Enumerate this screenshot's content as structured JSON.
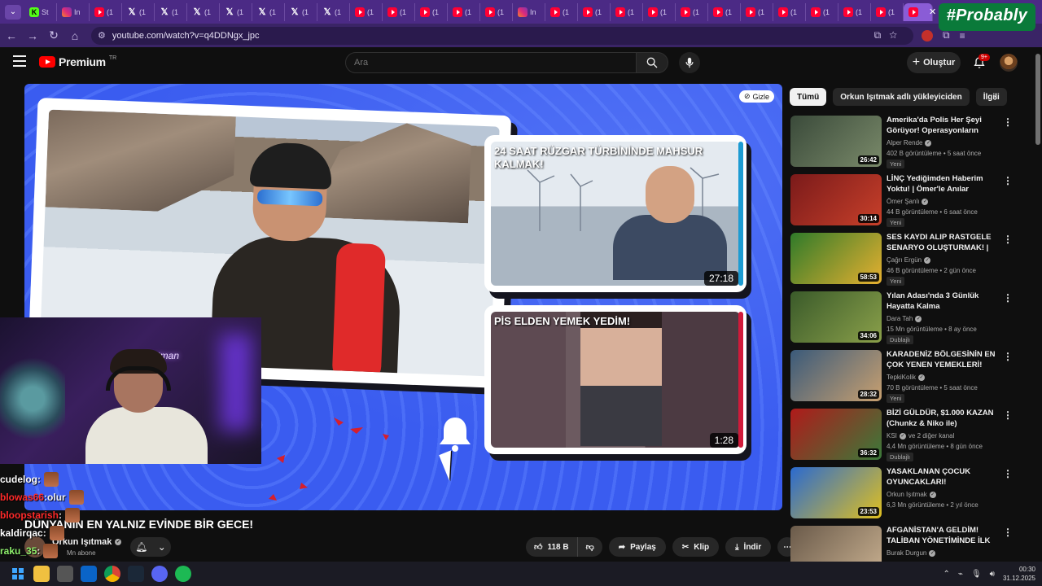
{
  "browser": {
    "tabs": [
      {
        "icon": "kick",
        "title": "St"
      },
      {
        "icon": "instagram",
        "title": "In"
      },
      {
        "icon": "youtube",
        "title": "(1"
      },
      {
        "icon": "x",
        "title": "(1"
      },
      {
        "icon": "x",
        "title": "(1"
      },
      {
        "icon": "x",
        "title": "(1"
      },
      {
        "icon": "x",
        "title": "(1"
      },
      {
        "icon": "x",
        "title": "(1"
      },
      {
        "icon": "x",
        "title": "(1"
      },
      {
        "icon": "x",
        "title": "(1"
      },
      {
        "icon": "youtube",
        "title": "(1"
      },
      {
        "icon": "youtube",
        "title": "(1"
      },
      {
        "icon": "youtube",
        "title": "(1"
      },
      {
        "icon": "youtube",
        "title": "(1"
      },
      {
        "icon": "youtube",
        "title": "(1"
      },
      {
        "icon": "instagram",
        "title": "In"
      },
      {
        "icon": "youtube",
        "title": "(1"
      },
      {
        "icon": "youtube",
        "title": "(1"
      },
      {
        "icon": "youtube",
        "title": "(1"
      },
      {
        "icon": "youtube",
        "title": "(1"
      },
      {
        "icon": "youtube",
        "title": "(1"
      },
      {
        "icon": "youtube",
        "title": "(1"
      },
      {
        "icon": "youtube",
        "title": "(1"
      },
      {
        "icon": "youtube",
        "title": "(1"
      },
      {
        "icon": "youtube",
        "title": "(1"
      },
      {
        "icon": "youtube",
        "title": "(1"
      },
      {
        "icon": "youtube",
        "title": "(1"
      }
    ],
    "active_tab_close": "✕",
    "url": "youtube.com/watch?v=q4DDNgx_jpc"
  },
  "overlay": {
    "brand_badge": "#Probably"
  },
  "youtube": {
    "logo_text": "Premium",
    "logo_tr": "TR",
    "search_placeholder": "Ara",
    "create_label": "Oluştur",
    "notif_count": "9+"
  },
  "player": {
    "hide_label": "Gizle",
    "card1_title": "24 SAAT RÜZGAR TÜRBİNİNDE MAHSUR KALMAK!",
    "card1_duration": "27:18",
    "card2_title": "PİS ELDEN YEMEK YEDİM!",
    "card2_duration": "1:28",
    "webcam_neon": "hotman"
  },
  "chat": [
    {
      "user": "cudelog",
      "sep": " :",
      "text": "",
      "color": "#ffffff"
    },
    {
      "user": "blowas66",
      "sep": " :",
      "text": " olur",
      "color": "#ff2a2a"
    },
    {
      "user": "bloopstarish",
      "sep": " :",
      "text": "",
      "color": "#ff2a2a"
    },
    {
      "user": "kaldirqac",
      "sep": " :",
      "text": "",
      "color": "#ffffff"
    },
    {
      "user": "raku_35",
      "sep": " :",
      "text": "",
      "color": "#8ef06c"
    }
  ],
  "video": {
    "title": "DÜNYANIN EN YALNIZ EVİNDE BİR GECE!",
    "channel": "Orkun Işıtmak",
    "subs": "Mn abone",
    "likes": "118 B",
    "share": "Paylaş",
    "clip": "Klip",
    "download": "İndir"
  },
  "chips": [
    "Tümü",
    "Orkun Işıtmak adlı yükleyiciden",
    "İlgili"
  ],
  "recommendations": [
    {
      "title": "Amerika'da Polis Her Şeyi Görüyor! Operasyonların Perde...",
      "channel": "Alper Rende",
      "meta": "402 B görüntüleme • 5 saat önce",
      "tag": "Yeni",
      "duration": "26:42",
      "colors": [
        "#3a4a3a",
        "#7a8a6a"
      ]
    },
    {
      "title": "LİNÇ Yediğimden Haberim Yoktu! | Ömer'le Anılar @gokalaf",
      "channel": "Ömer Şanlı",
      "meta": "44 B görüntüleme • 6 saat önce",
      "tag": "Yeni",
      "duration": "30:14",
      "colors": [
        "#7a1a1a",
        "#c8402a"
      ]
    },
    {
      "title": "SES KAYDI ALIP RASTGELE SENARYO OLUŞTURMAK! | Th...",
      "channel": "Çağrı Ergün",
      "meta": "46 B görüntüleme • 2 gün önce",
      "tag": "Yeni",
      "duration": "58:53",
      "colors": [
        "#2f7a2a",
        "#e6b030"
      ]
    },
    {
      "title": "Yılan Adası'nda 3 Günlük Hayatta Kalma",
      "channel": "Dara Tah",
      "meta": "15 Mn görüntüleme • 8 ay önce",
      "tag": "Dublajlı",
      "duration": "34:06",
      "colors": [
        "#3a5a2a",
        "#8aa04a"
      ]
    },
    {
      "title": "KARADENİZ BÖLGESİNİN EN ÇOK YENEN YEMEKLERİ!",
      "channel": "TepkiKolik",
      "meta": "70 B görüntüleme • 5 saat önce",
      "tag": "Yeni",
      "duration": "28:32",
      "colors": [
        "#3a5a7a",
        "#c8a070"
      ]
    },
    {
      "title": "BİZİ GÜLDÜR, $1.000 KAZAN (Chunkz & Niko ile)",
      "channel": "KSI",
      "channel_extra": "ve 2 diğer kanal",
      "meta": "4,4 Mn görüntüleme • 8 gün önce",
      "tag": "Dublajlı",
      "duration": "36:32",
      "colors": [
        "#b01a1a",
        "#3a7a3a"
      ]
    },
    {
      "title": "YASAKLANAN ÇOCUK OYUNCAKLARI!",
      "channel": "Orkun Işıtmak",
      "meta": "6,3 Mn görüntüleme • 2 yıl önce",
      "tag": "",
      "duration": "23:53",
      "colors": [
        "#2a6ad0",
        "#e0c020"
      ]
    },
    {
      "title": "AFGANİSTAN'A GELDİM! TALİBAN YÖNETİMİNDE İLK ...",
      "channel": "Burak Durgun",
      "meta": "",
      "tag": "",
      "duration": "",
      "colors": [
        "#6a5a4a",
        "#c8b090"
      ]
    }
  ],
  "taskbar": {
    "time": "00:30",
    "date": "31.12.2025"
  }
}
